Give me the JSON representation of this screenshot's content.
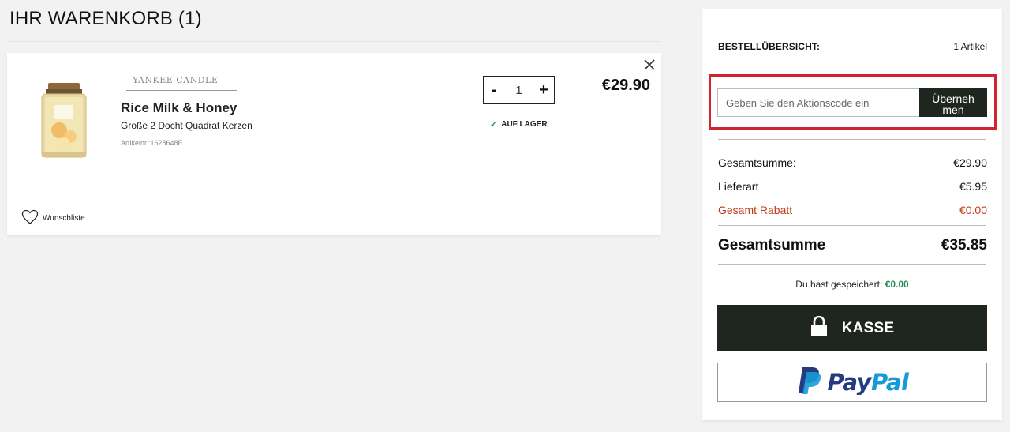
{
  "page": {
    "title": "IHR WARENKORB (1)"
  },
  "cart_item": {
    "brand": "YANKEE CANDLE",
    "name": "Rice Milk & Honey",
    "description": "Große 2 Docht Quadrat Kerzen",
    "sku": "Artikelnr.:1628648E",
    "quantity": "1",
    "qty_minus": "-",
    "qty_plus": "+",
    "stock_status": "AUF LAGER",
    "price": "€29.90",
    "wishlist_label": "Wunschliste"
  },
  "summary": {
    "header_label": "BESTELLÜBERSICHT:",
    "item_count": "1 Artikel",
    "promo_placeholder": "Geben Sie den Aktionscode ein",
    "promo_button_line1": "Überneh",
    "promo_button_line2": "men",
    "subtotal_label": "Gesamtsumme:",
    "subtotal_value": "€29.90",
    "shipping_label": "Lieferart",
    "shipping_value": "€5.95",
    "discount_label": "Gesamt Rabatt",
    "discount_value": "€0.00",
    "total_label": "Gesamtsumme",
    "total_value": "€35.85",
    "saved_label": "Du hast gespeichert:",
    "saved_value": "€0.00",
    "checkout_label": "KASSE",
    "paypal_pay": "Pay",
    "paypal_pal": "Pal"
  },
  "colors": {
    "dark_button": "#1f2620",
    "highlight": "#d0242f",
    "discount": "#c0391b",
    "saved": "#2b8a5c",
    "paypal_dark": "#253b80",
    "paypal_light": "#179bd7"
  }
}
